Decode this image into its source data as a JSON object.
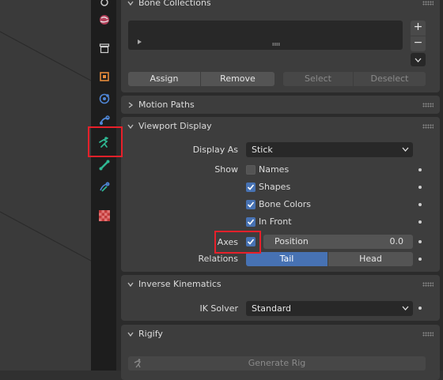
{
  "tabs": [
    "tool-icon",
    "world-icon",
    "collection-icon",
    "object-icon",
    "physics-icon",
    "constraints-icon",
    "armature-data-icon",
    "bone-icon",
    "bone-constraint-icon",
    "texture-icon"
  ],
  "bone_collections": {
    "title": "Bone Collections",
    "add_label": "+",
    "remove_label": "−",
    "assign_label": "Assign",
    "remove_btn_label": "Remove",
    "select_label": "Select",
    "deselect_label": "Deselect"
  },
  "motion_paths": {
    "title": "Motion Paths"
  },
  "viewport_display": {
    "title": "Viewport Display",
    "display_as_label": "Display As",
    "display_as_value": "Stick",
    "show_label": "Show",
    "names_label": "Names",
    "names_checked": false,
    "shapes_label": "Shapes",
    "shapes_checked": true,
    "bone_colors_label": "Bone Colors",
    "bone_colors_checked": true,
    "in_front_label": "In Front",
    "in_front_checked": true,
    "axes_label": "Axes",
    "axes_checked": true,
    "position_label": "Position",
    "position_value": "0.0",
    "relations_label": "Relations",
    "relations_options": [
      "Tail",
      "Head"
    ],
    "relations_selected": "Tail"
  },
  "inverse_kinematics": {
    "title": "Inverse Kinematics",
    "ik_solver_label": "IK Solver",
    "ik_solver_value": "Standard"
  },
  "rigify": {
    "title": "Rigify",
    "generate_label": "Generate Rig"
  },
  "colors": {
    "accent": "#4772b3",
    "highlight": "#e8202a",
    "active_icon": "#2fb893"
  }
}
